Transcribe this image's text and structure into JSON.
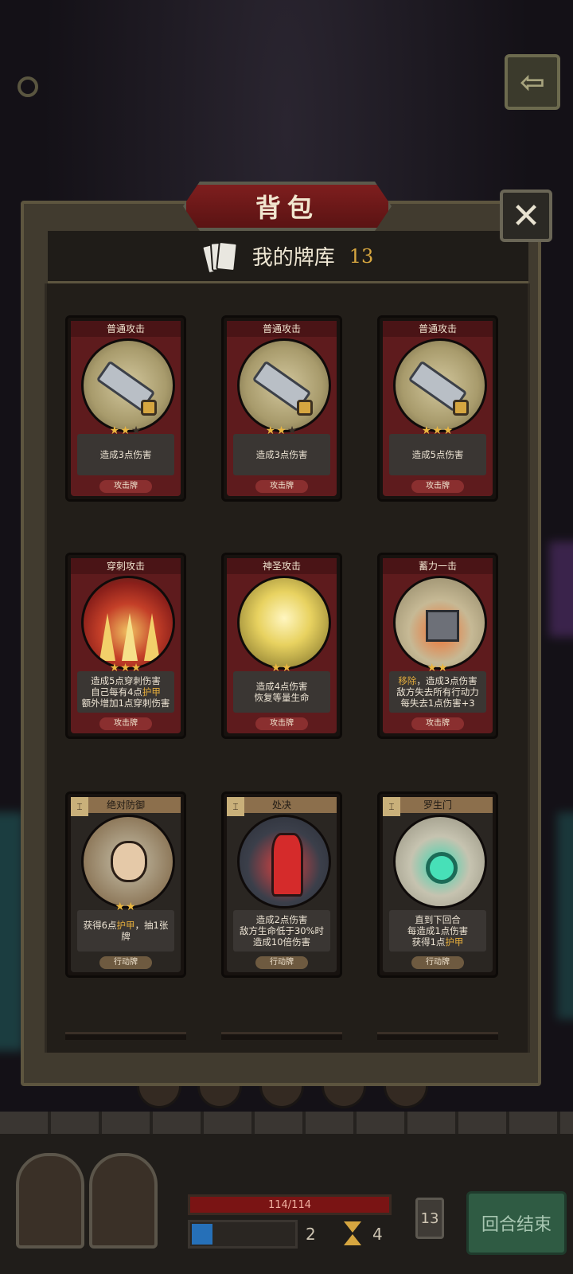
{
  "panel": {
    "title": "背包",
    "close_symbol": "✕",
    "deck_title": "我的牌库",
    "deck_count": "13"
  },
  "nav": {
    "back_symbol": "⇦"
  },
  "cards": [
    {
      "name": "普通攻击",
      "desc": "造成3点伤害",
      "type": "攻击牌",
      "stars_on": "★★",
      "stars_off": "★",
      "kind": "attack",
      "icon": "sword-icon"
    },
    {
      "name": "普通攻击",
      "desc": "造成3点伤害",
      "type": "攻击牌",
      "stars_on": "★★",
      "stars_off": "★",
      "kind": "attack",
      "icon": "sword-icon"
    },
    {
      "name": "普通攻击",
      "desc": "造成5点伤害",
      "type": "攻击牌",
      "stars_on": "★★★",
      "stars_off": "",
      "kind": "attack",
      "icon": "sword-icon"
    },
    {
      "name": "穿刺攻击",
      "desc_lines": [
        "造成5点穿刺伤害",
        "自己每有4点",
        "护甲",
        "额外增加1点穿刺伤害"
      ],
      "type": "攻击牌",
      "stars_on": "★★★",
      "stars_off": "",
      "kind": "attack",
      "icon": "spikes-icon"
    },
    {
      "name": "神圣攻击",
      "desc_lines": [
        "造成4点伤害",
        "恢复等量生命"
      ],
      "type": "攻击牌",
      "stars_on": "★★",
      "stars_off": "",
      "kind": "attack",
      "icon": "holy-light-icon"
    },
    {
      "name": "蓄力一击",
      "desc_lines": [
        "移除",
        "，造成3点伤害",
        "敌方失去所有行动力",
        "每失去1点伤害+3"
      ],
      "type": "攻击牌",
      "stars_on": "★★",
      "stars_off": "",
      "kind": "attack",
      "icon": "hammer-icon"
    },
    {
      "name": "绝对防御",
      "desc_lines": [
        "获得6点",
        "护甲",
        "，抽1张牌"
      ],
      "type": "行动牌",
      "stars_on": "★★",
      "stars_off": "",
      "kind": "action",
      "icon": "dwarf-shield-icon"
    },
    {
      "name": "处决",
      "desc_lines": [
        "造成2点伤害",
        "敌方生命低于30%时",
        "造成10倍伤害"
      ],
      "type": "行动牌",
      "stars_on": "",
      "stars_off": "",
      "kind": "action",
      "icon": "executioner-icon"
    },
    {
      "name": "罗生门",
      "desc_lines": [
        "直到下回合",
        "每造成1点伤害",
        "获得1点",
        "护甲"
      ],
      "type": "行动牌",
      "stars_on": "",
      "stars_off": "",
      "kind": "action",
      "icon": "demon-gate-icon"
    }
  ],
  "type_marker_symbol": "⌶",
  "hud": {
    "hp_text": "114/114",
    "energy_value": "2",
    "turn_value": "4",
    "deck_pile_count": "13",
    "end_turn_label": "回合结束"
  }
}
